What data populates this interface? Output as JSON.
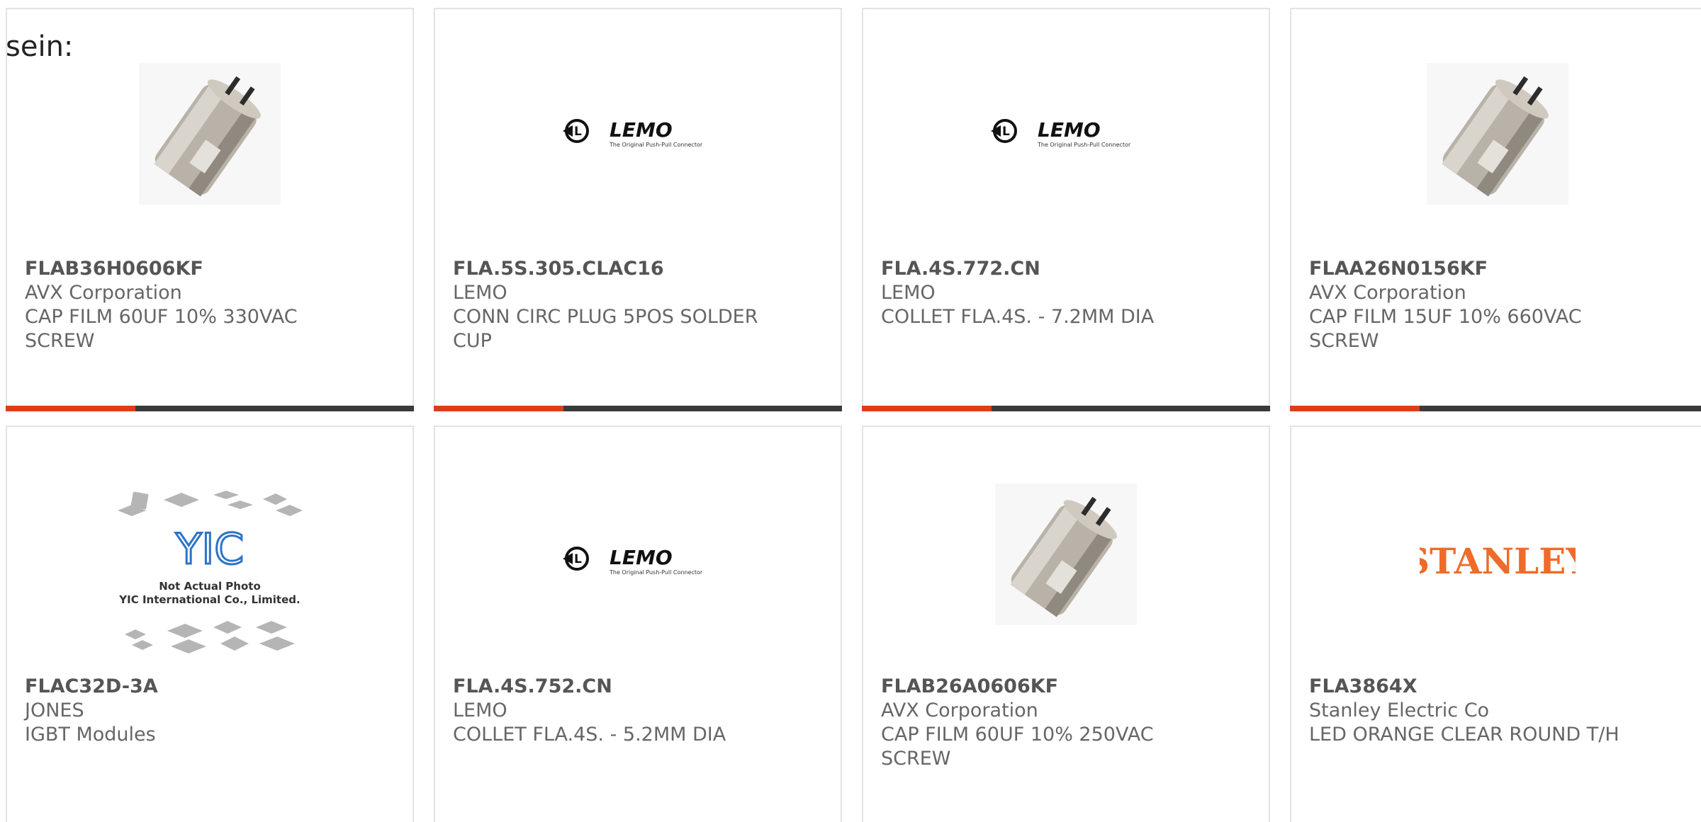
{
  "intro_text": "sein:",
  "colors": {
    "accent": "#e03c16",
    "bar": "#3a3a3a",
    "border": "#e3e3e3",
    "text": "#666666",
    "stanley_orange": "#ef6b2a"
  },
  "lemo_logo": {
    "name": "LEMO",
    "tagline": "The Original Push-Pull Connector"
  },
  "stanley_logo": {
    "name": "STANLEY"
  },
  "yic_placeholder": {
    "brand": "YIC",
    "line1": "Not Actual Photo",
    "line2": "YIC International Co., Limited."
  },
  "products": [
    {
      "part": "FLAB36H0606KF",
      "manufacturer": "AVX Corporation",
      "description": "CAP FILM 60UF 10% 330VAC SCREW",
      "image": "capacitor-photo"
    },
    {
      "part": "FLA.5S.305.CLAC16",
      "manufacturer": "LEMO",
      "description": "CONN CIRC PLUG 5POS SOLDER CUP",
      "image": "lemo-logo"
    },
    {
      "part": "FLA.4S.772.CN",
      "manufacturer": "LEMO",
      "description": "COLLET FLA.4S. - 7.2MM DIA",
      "image": "lemo-logo"
    },
    {
      "part": "FLAA26N0156KF",
      "manufacturer": "AVX Corporation",
      "description": "CAP FILM 15UF 10% 660VAC SCREW",
      "image": "capacitor-photo"
    },
    {
      "part": "FLAC32D-3A",
      "manufacturer": "JONES",
      "description": "IGBT Modules",
      "image": "yic-placeholder"
    },
    {
      "part": "FLA.4S.752.CN",
      "manufacturer": "LEMO",
      "description": "COLLET FLA.4S. - 5.2MM DIA",
      "image": "lemo-logo"
    },
    {
      "part": "FLAB26A0606KF",
      "manufacturer": "AVX Corporation",
      "description": "CAP FILM 60UF 10% 250VAC SCREW",
      "image": "capacitor-photo"
    },
    {
      "part": "FLA3864X",
      "manufacturer": "Stanley Electric Co",
      "description": "LED ORANGE CLEAR ROUND T/H",
      "image": "stanley-logo"
    }
  ]
}
